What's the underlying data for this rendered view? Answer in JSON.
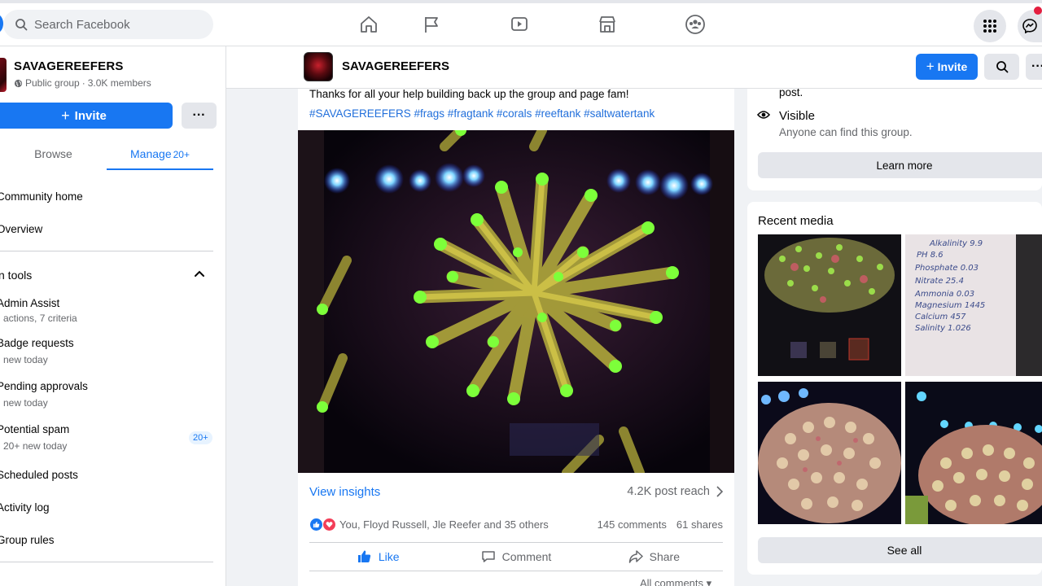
{
  "topbar": {
    "search_placeholder": "Search Facebook",
    "nav": [
      "home-icon",
      "flag-icon",
      "video-icon",
      "marketplace-icon",
      "groups-icon"
    ],
    "right": [
      "menu-grid-icon",
      "messenger-icon"
    ]
  },
  "group": {
    "name": "SAVAGEREEFERS",
    "privacy": "Public group",
    "separator": " · ",
    "members": "3.0K members"
  },
  "sidebar": {
    "invite_label": "Invite",
    "more_label": "···",
    "tabs": [
      {
        "label": "Browse",
        "count": ""
      },
      {
        "label": "Manage",
        "count": "20+"
      }
    ],
    "items": [
      {
        "label": "Community home"
      },
      {
        "label": "Overview"
      }
    ],
    "tools_label": "n tools",
    "tools": [
      {
        "label": "Admin Assist",
        "sub": "actions, 7 criteria"
      },
      {
        "label": "Badge requests",
        "sub": "new today"
      },
      {
        "label": "Pending approvals",
        "sub": "new today"
      },
      {
        "label": "Potential spam",
        "sub": "20+ new today",
        "badge": "20+"
      },
      {
        "label": "Scheduled posts"
      },
      {
        "label": "Activity log"
      },
      {
        "label": "Group rules"
      }
    ]
  },
  "header": {
    "name": "SAVAGEREEFERS",
    "invite_label": "Invite",
    "more_label": "···"
  },
  "post": {
    "text": "Thanks for all your help building back up the group and page fam!",
    "tags": "#SAVAGEREEFERS #frags #fragtank #corals #reeftank #saltwatertank",
    "insights_label": "View insights",
    "reach": "4.2K post reach",
    "reactions_text": "You, Floyd Russell, Jle Reefer and 35 others",
    "comments": "145 comments",
    "shares": "61 shares",
    "actions": {
      "like": "Like",
      "comment": "Comment",
      "share": "Share"
    },
    "all_comments": "All comments"
  },
  "about": {
    "fragment": "post.",
    "visible_title": "Visible",
    "visible_sub": "Anyone can find this group.",
    "learn_more": "Learn more"
  },
  "media": {
    "title": "Recent media",
    "see_all": "See all",
    "note_lines": [
      "Alkalinity 9.9",
      "PH 8.6",
      "Phosphate 0.03",
      "Nitrate 25.4",
      "Ammonia 0.03",
      "Magnesium 1445",
      "Calcium 457",
      "Salinity 1.026"
    ]
  },
  "colors": {
    "accent": "#1877f2",
    "love": "#f33e58",
    "page_bg": "#f0f2f5"
  }
}
